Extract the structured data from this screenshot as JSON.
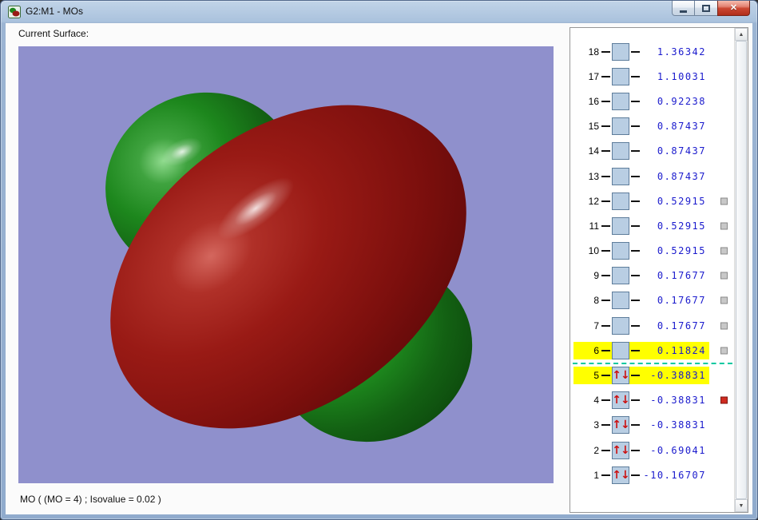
{
  "window": {
    "title": "G2:M1 - MOs"
  },
  "left_panel": {
    "current_surface_label": "Current Surface:",
    "status_text": "MO ( (MO = 4) ; Isovalue = 0.02 )"
  },
  "icons": {
    "close": "✕",
    "scroll_up": "▲",
    "scroll_down": "▼",
    "spin_up": "↑",
    "spin_down": "↓"
  },
  "colors": {
    "titlebar_blue": "#aac2dd",
    "viewport_background": "#8f90cc",
    "positive_lobe_red": "#991a15",
    "negative_lobe_green": "#1d871d",
    "selection_highlight_yellow": "#ffff00",
    "energy_value_blue": "#1a1acd",
    "spin_arrow_red": "#cc1111",
    "mo_box_blue": "#b9cee3",
    "homo_lumo_divider_teal": "#00c8a0",
    "marker_gray": "#c8c8c8",
    "marker_red": "#cf2b20"
  },
  "mo_list": {
    "rows": [
      {
        "n": "18",
        "energy": "1.36342",
        "occupied": false,
        "highlight": false,
        "marker": "none"
      },
      {
        "n": "17",
        "energy": "1.10031",
        "occupied": false,
        "highlight": false,
        "marker": "none"
      },
      {
        "n": "16",
        "energy": "0.92238",
        "occupied": false,
        "highlight": false,
        "marker": "none"
      },
      {
        "n": "15",
        "energy": "0.87437",
        "occupied": false,
        "highlight": false,
        "marker": "none"
      },
      {
        "n": "14",
        "energy": "0.87437",
        "occupied": false,
        "highlight": false,
        "marker": "none"
      },
      {
        "n": "13",
        "energy": "0.87437",
        "occupied": false,
        "highlight": false,
        "marker": "none"
      },
      {
        "n": "12",
        "energy": "0.52915",
        "occupied": false,
        "highlight": false,
        "marker": "gray"
      },
      {
        "n": "11",
        "energy": "0.52915",
        "occupied": false,
        "highlight": false,
        "marker": "gray"
      },
      {
        "n": "10",
        "energy": "0.52915",
        "occupied": false,
        "highlight": false,
        "marker": "gray"
      },
      {
        "n": "9",
        "energy": "0.17677",
        "occupied": false,
        "highlight": false,
        "marker": "gray"
      },
      {
        "n": "8",
        "energy": "0.17677",
        "occupied": false,
        "highlight": false,
        "marker": "gray"
      },
      {
        "n": "7",
        "energy": "0.17677",
        "occupied": false,
        "highlight": false,
        "marker": "gray"
      },
      {
        "n": "6",
        "energy": "0.11824",
        "occupied": false,
        "highlight": true,
        "marker": "gray"
      },
      {
        "n": "5",
        "energy": "-0.38831",
        "occupied": true,
        "highlight": true,
        "marker": "none"
      },
      {
        "n": "4",
        "energy": "-0.38831",
        "occupied": true,
        "highlight": false,
        "marker": "red"
      },
      {
        "n": "3",
        "energy": "-0.38831",
        "occupied": true,
        "highlight": false,
        "marker": "none"
      },
      {
        "n": "2",
        "energy": "-0.69041",
        "occupied": true,
        "highlight": false,
        "marker": "none"
      },
      {
        "n": "1",
        "energy": "-10.16707",
        "occupied": true,
        "highlight": false,
        "marker": "none"
      }
    ]
  }
}
